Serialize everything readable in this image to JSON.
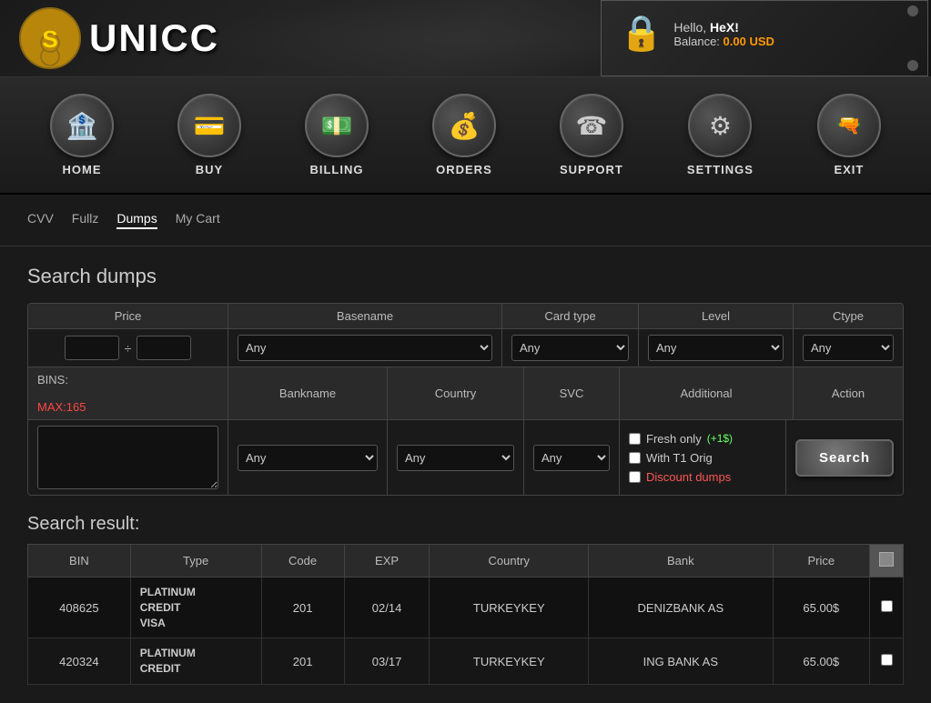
{
  "logo": {
    "icon_symbol": "S",
    "text": "UNICC"
  },
  "header": {
    "hello_label": "Hello,",
    "username": "HeX!",
    "balance_label": "Balance:",
    "balance_amount": "0.00 USD"
  },
  "nav": {
    "items": [
      {
        "id": "home",
        "label": "HOME",
        "icon": "🏦"
      },
      {
        "id": "buy",
        "label": "BUY",
        "icon": "💳"
      },
      {
        "id": "billing",
        "label": "BILLING",
        "icon": "💵"
      },
      {
        "id": "orders",
        "label": "ORDERS",
        "icon": "💰"
      },
      {
        "id": "support",
        "label": "SUPPORT",
        "icon": "☎"
      },
      {
        "id": "settings",
        "label": "SETTINGS",
        "icon": "⚙"
      },
      {
        "id": "exit",
        "label": "EXIT",
        "icon": "🔫"
      }
    ]
  },
  "breadcrumb": {
    "items": [
      {
        "label": "CVV",
        "active": false
      },
      {
        "label": "Fullz",
        "active": false
      },
      {
        "label": "Dumps",
        "active": true
      },
      {
        "label": "My Cart",
        "active": false
      }
    ]
  },
  "search": {
    "title": "Search dumps",
    "price_label": "Price",
    "basename_label": "Basename",
    "cardtype_label": "Card type",
    "level_label": "Level",
    "ctype_label": "Ctype",
    "bins_label": "BINS:",
    "bins_hint": "MAX:165",
    "bankname_label": "Bankname",
    "country_label": "Country",
    "svc_label": "SVC",
    "additional_label": "Additional",
    "action_label": "Action",
    "any_option": "Any",
    "fresh_only": "Fresh only",
    "fresh_bonus": "(+1$)",
    "with_t1_orig": "With T1 Orig",
    "discount_dumps": "Discount dumps",
    "search_button": "Search",
    "price_separator": "÷"
  },
  "results": {
    "title": "Search result:",
    "columns": [
      "BIN",
      "Type",
      "Code",
      "EXP",
      "Country",
      "Bank",
      "Price",
      ""
    ],
    "rows": [
      {
        "bin": "408625",
        "type_line1": "PLATINUM",
        "type_line2": "CREDIT",
        "type_line3": "VISA",
        "code": "201",
        "exp": "02/14",
        "country": "TURKEYKEY",
        "bank": "DENIZBANK AS",
        "price": "65.00$"
      },
      {
        "bin": "420324",
        "type_line1": "PLATINUM",
        "type_line2": "CREDIT",
        "type_line3": "",
        "code": "201",
        "exp": "03/17",
        "country": "TURKEYKEY",
        "bank": "ING BANK AS",
        "price": "65.00$"
      }
    ]
  }
}
